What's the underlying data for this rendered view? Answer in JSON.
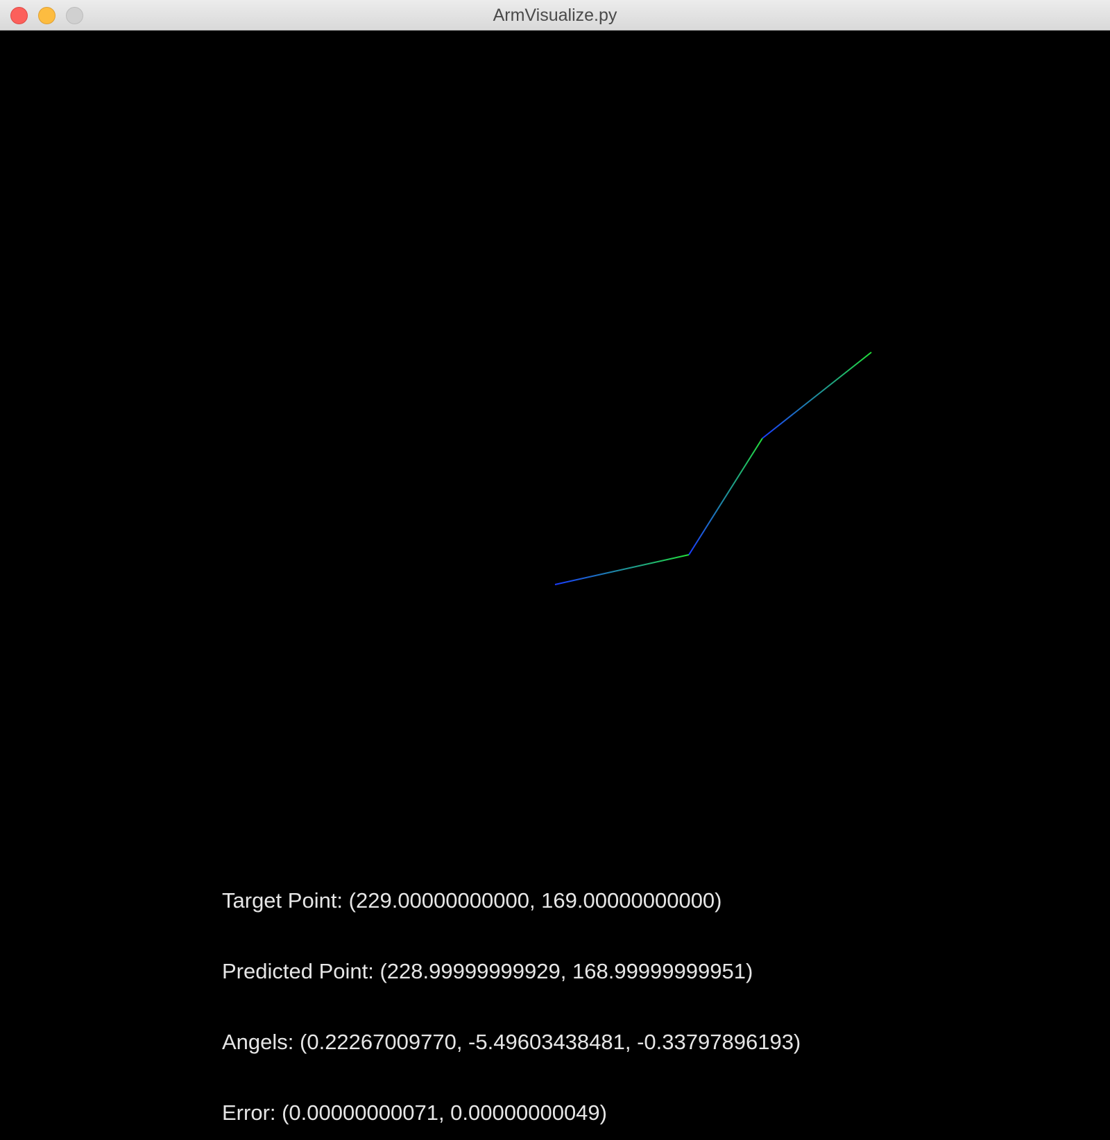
{
  "window": {
    "title": "ArmVisualize.py"
  },
  "arm": {
    "segment_colors": [
      "#1a3cff",
      "#22e03a"
    ]
  },
  "info": {
    "target_point": "Target Point: (229.00000000000, 169.00000000000)",
    "predicted_point": "Predicted Point: (228.99999999929, 168.99999999951)",
    "angles": "Angels: (0.22267009770, -5.49603438481, -0.33797896193)",
    "error": "Error: (0.00000000071, 0.00000000049)"
  }
}
